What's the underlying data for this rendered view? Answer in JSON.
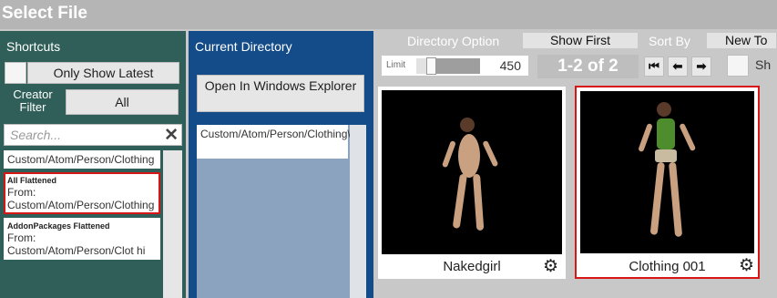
{
  "window": {
    "title": "Select File"
  },
  "shortcuts": {
    "header": "Shortcuts",
    "only_show_latest": "Only Show Latest",
    "creator_filter_label": "Creator Filter",
    "creator_filter_value": "All",
    "search_placeholder": "Search...",
    "items": [
      {
        "name": "",
        "from": "Custom/Atom/Person/Clothing"
      },
      {
        "name": "All Flattened",
        "from": "From: Custom/Atom/Person/Clothing",
        "selected": true
      },
      {
        "name": "AddonPackages Flattened",
        "from": "From: Custom/Atom/Person/Clot hi"
      }
    ]
  },
  "current_directory": {
    "header": "Current Directory",
    "open_explorer": "Open In Windows Explorer",
    "path": "Custom/Atom/Person/Clothing\\"
  },
  "toolbar": {
    "directory_option": "Directory Option",
    "show_first": "Show First",
    "sort_by": "Sort By",
    "sort_value": "New To",
    "limit_label": "Limit",
    "limit_value": "450",
    "limit_fraction": 0.18,
    "page_info": "1-2 of 2",
    "first_icon": "⏮",
    "prev_icon": "⬅",
    "next_icon": "➡",
    "show_label": "Sh"
  },
  "files": [
    {
      "name": "Nakedgirl",
      "selected": false
    },
    {
      "name": "Clothing 001",
      "selected": true
    }
  ],
  "colors": {
    "shortcuts_panel": "#2f5f58",
    "current_dir_panel": "#134c88",
    "selection_outline": "#d91616"
  }
}
